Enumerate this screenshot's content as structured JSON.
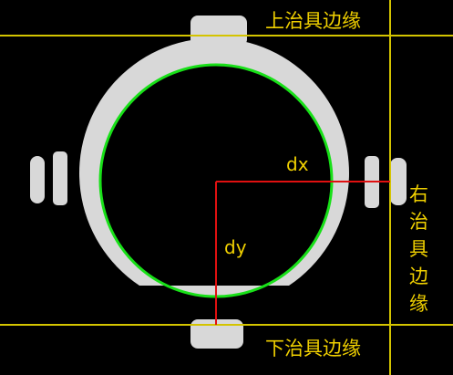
{
  "labels": {
    "top_edge": "上治具边缘",
    "bottom_edge": "下治具边缘",
    "right_edge": [
      "右",
      "治",
      "具",
      "边",
      "缘"
    ],
    "dx": "dx",
    "dy": "dy"
  },
  "colors": {
    "background": "#000000",
    "part": "#d8d8d8",
    "fixture_line": "#d4c400",
    "circle_fit": "#18e018",
    "measure_line": "#e01010",
    "text": "#f0d000"
  }
}
